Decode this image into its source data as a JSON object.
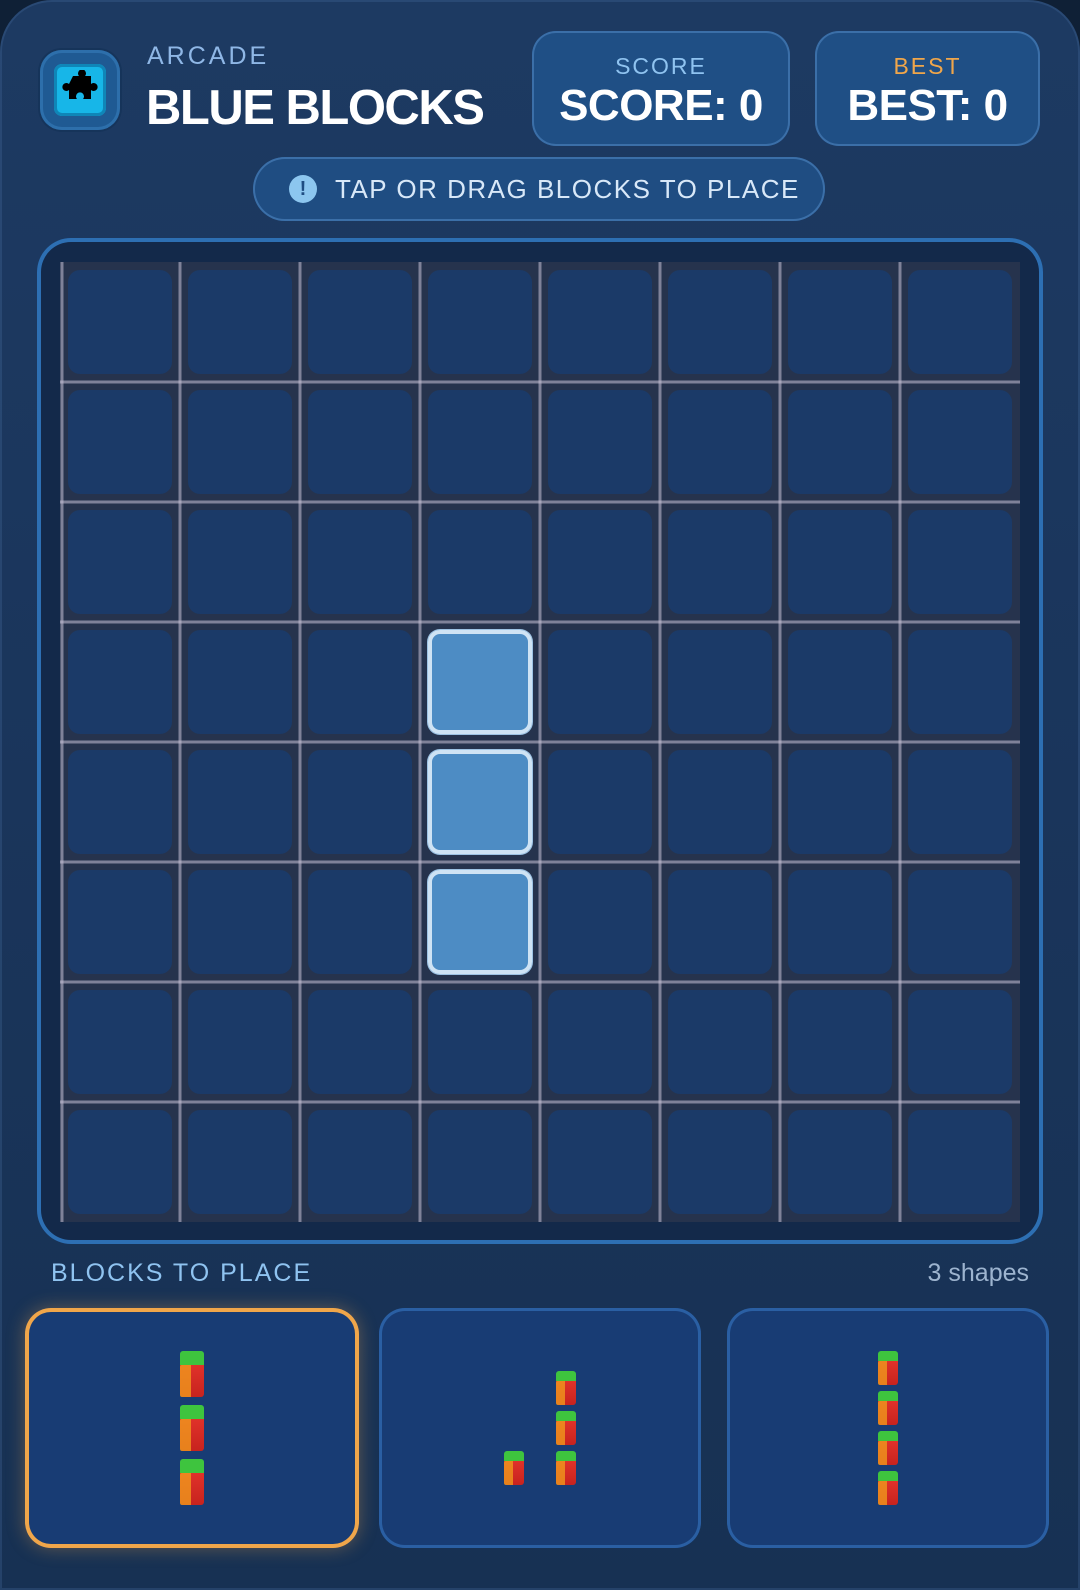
{
  "header": {
    "subtitle": "ARCADE",
    "title": "BLUE BLOCKS",
    "score": {
      "label": "SCORE",
      "value_text": "SCORE: 0"
    },
    "best": {
      "label": "BEST",
      "value_text": "BEST: 0"
    }
  },
  "hint": {
    "icon": "info-icon",
    "glyph": "!",
    "text": "TAP OR DRAG BLOCKS TO PLACE"
  },
  "board": {
    "rows": 8,
    "cols": 8,
    "filled_cells": [
      [
        3,
        3
      ],
      [
        4,
        3
      ],
      [
        5,
        3
      ]
    ]
  },
  "tray": {
    "label": "BLOCKS TO PLACE",
    "count_text": "3 shapes",
    "selected_index": 0,
    "pieces": [
      {
        "cells": [
          [
            0,
            0
          ],
          [
            1,
            0
          ],
          [
            2,
            0
          ]
        ]
      },
      {
        "cells": [
          [
            0,
            1
          ],
          [
            1,
            1
          ],
          [
            2,
            0
          ],
          [
            2,
            1
          ]
        ]
      },
      {
        "cells": [
          [
            0,
            0
          ],
          [
            1,
            0
          ],
          [
            2,
            0
          ],
          [
            3,
            0
          ]
        ]
      }
    ]
  },
  "colors": {
    "accent": "#2d6fb3",
    "filled_block": "#4d8cc4",
    "best_label": "#f0a64a",
    "score_label": "#8fc3f0",
    "selected_outline": "#f0a64a"
  }
}
